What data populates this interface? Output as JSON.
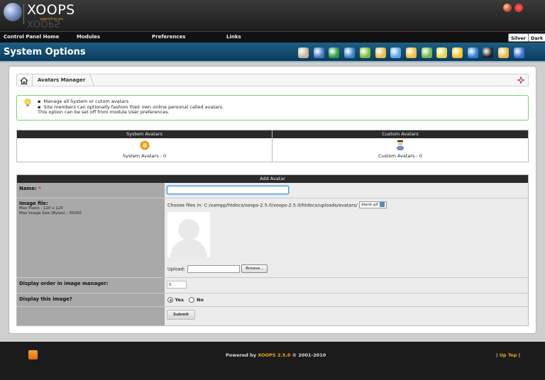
{
  "app": {
    "logo_text": "XOOPS",
    "powered_by": "powered by you"
  },
  "menu": {
    "items": [
      "Control Panel Home",
      "Modules",
      "Preferences",
      "Links"
    ],
    "themes": [
      "Silver",
      "Dark"
    ]
  },
  "page": {
    "title": "System Options",
    "module_icons": [
      "tools-icon",
      "monitor-icon",
      "blocks-icon",
      "edit-icon",
      "users-icon",
      "mail-icon",
      "images-icon",
      "brush-icon",
      "pen-icon",
      "maintenance-icon",
      "smilies-icon",
      "globe-icon",
      "graduation-icon",
      "trophy-icon",
      "help-ring-icon"
    ],
    "module_icon_colors": [
      "#c6b29a",
      "#4a79c6",
      "#2e9b45",
      "#3f85c8",
      "#7fbf3f",
      "#e0c04d",
      "#5aa7e5",
      "#f0c040",
      "#71b84a",
      "#e5d64d",
      "#f2c230",
      "#2f7fd6",
      "#222222",
      "#f0b848",
      "#3b6ed0"
    ]
  },
  "breadcrumb": {
    "label": "Avatars Manager"
  },
  "info": {
    "lines": [
      "Manage all System or cutom avatars",
      "Site members can optionally fashion their own online personal called avatars.",
      "This option can be set off from module User preferences."
    ]
  },
  "avatars": {
    "system_header": "System Avatars",
    "custom_header": "Custom Avatars",
    "system_label": "System Avatars : 0",
    "custom_label": "Custom Avatars : 0"
  },
  "form": {
    "title": "Add Avatar",
    "name_label": "Name:",
    "required_mark": "*",
    "name_value": "",
    "image_label": "Image file:",
    "max_pixels": "Max Pixels : 120 x 120",
    "max_size": "Max Image Size (Bytes) : 35000",
    "choose_files": "Choose files in: C:/xampp/htdocs/xoops-2.5.0/xoops-2.5.0/htdocs/uploads/avatars/",
    "selected_file": "blank.gif",
    "upload_label": "Upload:",
    "browse_label": "Browse...",
    "order_label": "Display order in image manager:",
    "order_value": "0",
    "display_label": "Display this image?",
    "yes_label": "Yes",
    "no_label": "No",
    "display_value": "Yes",
    "submit_label": "Submit"
  },
  "footer": {
    "powered_prefix": "Powered by",
    "product": "XOOPS 2.5.0",
    "copyright": "© 2001-2010",
    "up_top_prefix": "|",
    "up_top": "Up Top",
    "up_top_suffix": "|"
  }
}
